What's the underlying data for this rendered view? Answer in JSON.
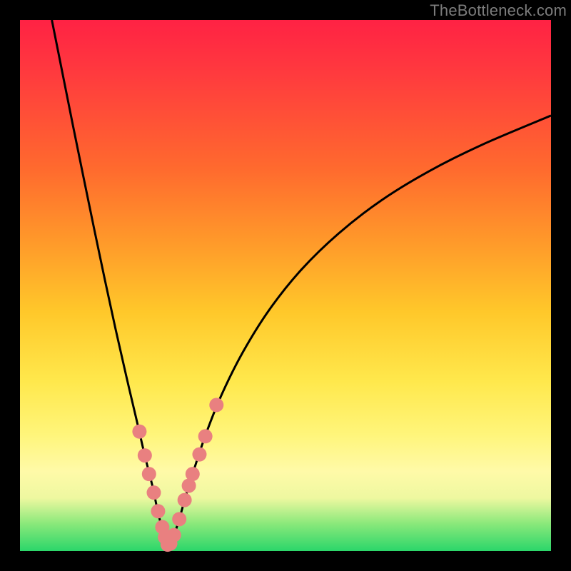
{
  "watermark": "TheBottleneck.com",
  "colors": {
    "bg": "#000000",
    "gradient_top": "#ff2244",
    "gradient_mid1": "#ff9a2a",
    "gradient_mid2": "#ffe84c",
    "gradient_bottom": "#2bd66a",
    "curve": "#000000",
    "marker_fill": "#e98080",
    "watermark": "#7c7c7c"
  },
  "chart_data": {
    "type": "line",
    "title": "",
    "xlabel": "",
    "ylabel": "",
    "xlim": [
      0,
      100
    ],
    "ylim": [
      0,
      100
    ],
    "grid": false,
    "series": [
      {
        "name": "left-branch",
        "x": [
          6.0,
          8.0,
          10.0,
          12.0,
          14.0,
          16.0,
          18.0,
          20.0,
          22.0,
          23.5,
          25.0,
          26.0,
          27.0,
          27.8
        ],
        "values": [
          100.0,
          90.0,
          80.0,
          70.2,
          60.5,
          51.0,
          41.8,
          33.0,
          24.5,
          18.0,
          12.0,
          7.2,
          3.5,
          1.2
        ]
      },
      {
        "name": "right-branch",
        "x": [
          28.2,
          29.0,
          30.0,
          31.0,
          32.5,
          35.0,
          38.0,
          42.0,
          47.0,
          53.0,
          60.0,
          68.0,
          77.0,
          87.0,
          100.0
        ],
        "values": [
          1.2,
          3.0,
          6.0,
          9.6,
          14.5,
          22.0,
          29.5,
          37.5,
          45.5,
          53.0,
          59.8,
          66.0,
          71.5,
          76.5,
          82.0
        ]
      },
      {
        "name": "markers",
        "x": [
          22.5,
          23.5,
          24.3,
          25.2,
          26.0,
          26.8,
          27.3,
          27.8,
          28.3,
          29.0,
          30.0,
          31.0,
          31.8,
          32.5,
          33.8,
          34.9,
          37.0
        ],
        "values": [
          22.5,
          18.0,
          14.5,
          11.0,
          7.5,
          4.5,
          2.6,
          1.2,
          1.4,
          3.0,
          6.0,
          9.6,
          12.3,
          14.5,
          18.2,
          21.6,
          27.5
        ]
      }
    ],
    "annotations": []
  }
}
